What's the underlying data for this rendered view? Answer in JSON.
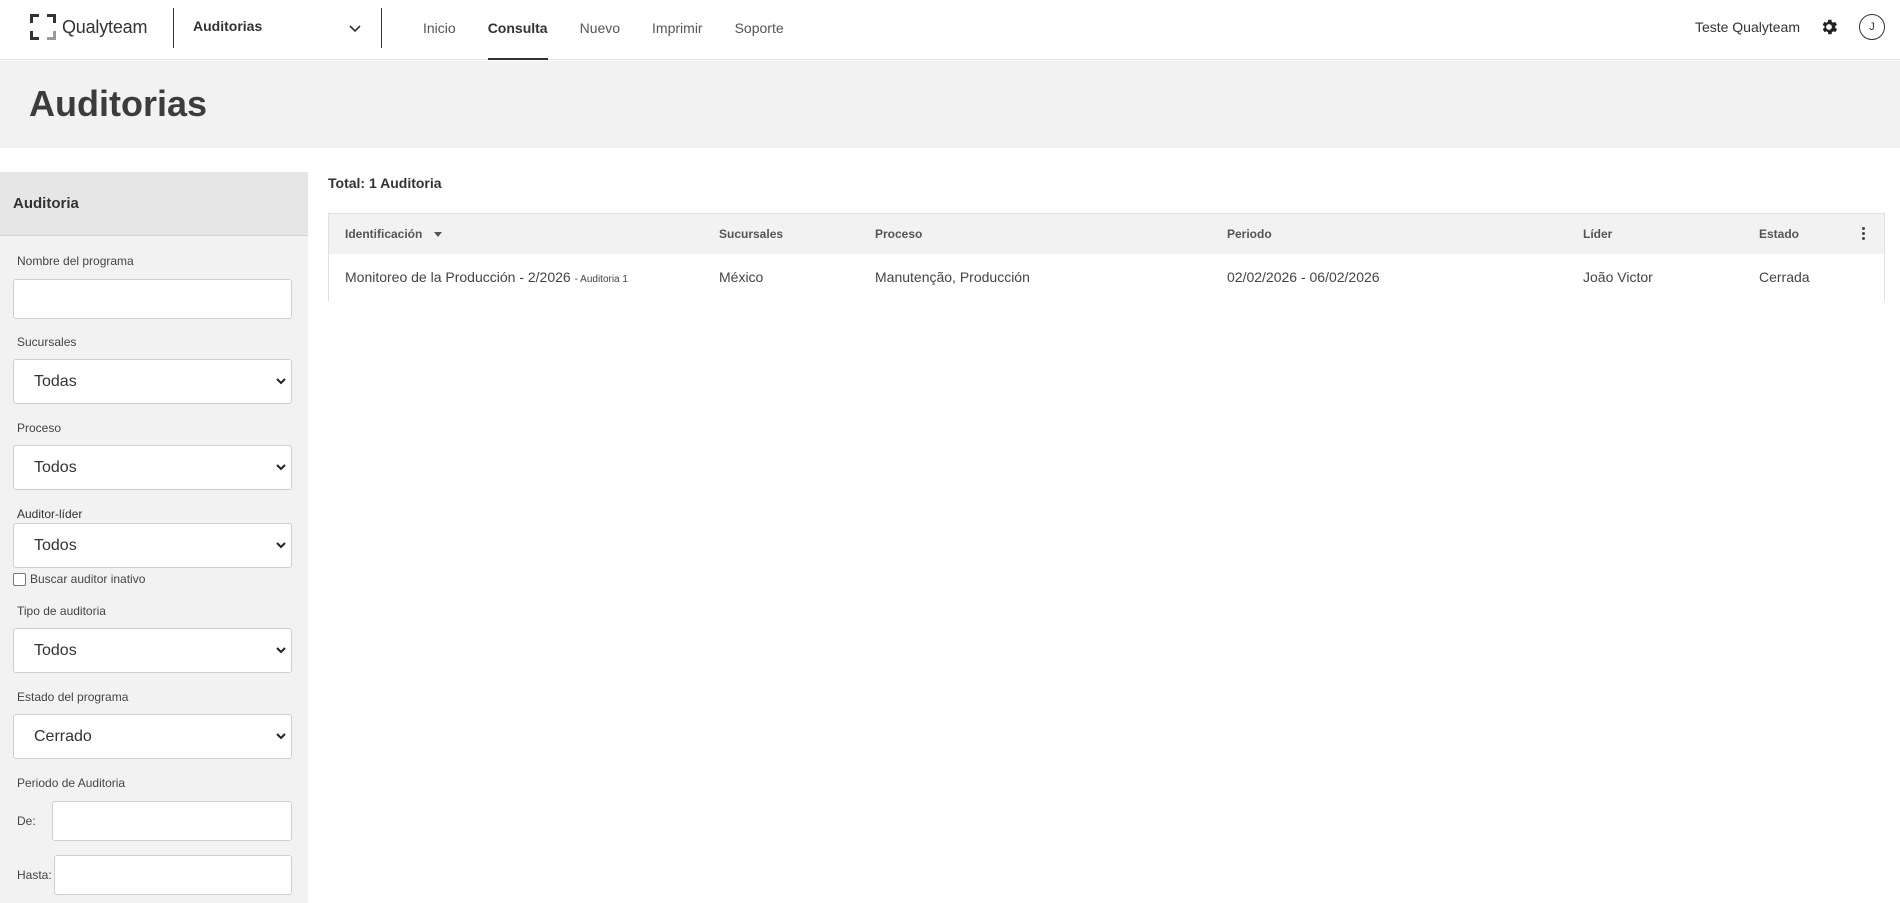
{
  "topbar": {
    "logo_text": "Qualyteam",
    "module": "Auditorias",
    "nav": [
      "Inicio",
      "Consulta",
      "Nuevo",
      "Imprimir",
      "Soporte"
    ],
    "active_nav": "Consulta",
    "user_name": "Teste Qualyteam",
    "avatar_initial": "J",
    "icons": {
      "settings": "gear-icon",
      "module_toggle": "chevron-down-icon"
    }
  },
  "page": {
    "title": "Auditorias"
  },
  "sidebar": {
    "title": "Auditoria",
    "program_name_label": "Nombre del programa",
    "program_name_value": "",
    "branches_label": "Sucursales",
    "branches_value": "Todas",
    "process_label": "Proceso",
    "process_value": "Todos",
    "lead_auditor_label": "Auditor-líder",
    "lead_auditor_value": "Todos",
    "inactive_auditor_label": "Buscar auditor inativo",
    "inactive_auditor_checked": false,
    "audit_type_label": "Tipo de auditoria",
    "audit_type_value": "Todos",
    "program_status_label": "Estado del programa",
    "program_status_value": "Cerrado",
    "period_label": "Periodo de Auditoria",
    "from_label": "De:",
    "to_label": "Hasta:"
  },
  "results": {
    "total": "Total: 1 Auditoria",
    "columns": [
      "Identificación",
      "Sucursales",
      "Proceso",
      "Periodo",
      "Líder",
      "Estado"
    ],
    "rows": [
      {
        "identification": "Monitoreo de la Producción - 2/2026",
        "sub": "- Auditoria 1",
        "branches": "México",
        "process": "Manutenção, Producción",
        "period": "02/02/2026 - 06/02/2026",
        "leader": "João Victor",
        "status": "Cerrada"
      }
    ]
  }
}
